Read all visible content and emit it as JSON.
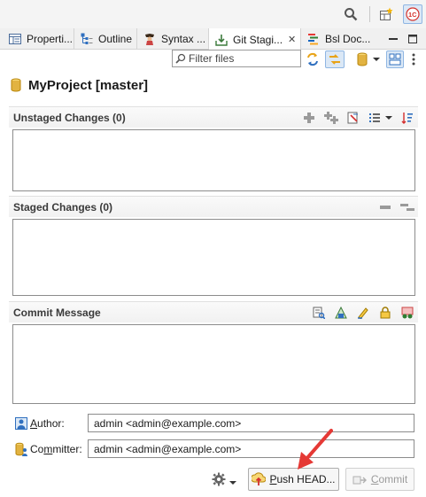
{
  "icons": {
    "search": "search-icon",
    "open_perspective": "open-perspective-icon",
    "perspective": "perspective-1c-icon",
    "properties_tab": "properties-icon",
    "outline_tab": "outline-icon",
    "syntax_tab": "syntax-icon",
    "git_staging_tab": "git-staging-icon",
    "bsl_doc_tab": "bsl-doc-icon",
    "repository": "repository-icon"
  },
  "tabs": [
    {
      "label": "Properti..."
    },
    {
      "label": "Outline"
    },
    {
      "label": "Syntax ..."
    },
    {
      "label": "Git Stagi...",
      "close": "✕"
    },
    {
      "label": "Bsl Doc..."
    }
  ],
  "filter": {
    "placeholder": "Filter files"
  },
  "repository": {
    "label": "MyProject [master]"
  },
  "unstaged": {
    "header": "Unstaged Changes (0)"
  },
  "staged": {
    "header": "Staged Changes (0)"
  },
  "commit_message": {
    "header": "Commit Message",
    "value": ""
  },
  "author": {
    "label": "Author:",
    "underline": "A",
    "rest": "uthor:",
    "value": "admin <admin@example.com>"
  },
  "committer": {
    "label": "Committer:",
    "underline": "m",
    "value": "admin <admin@example.com>"
  },
  "buttons": {
    "push_prefix": "",
    "push_underline": "P",
    "push_rest": "ush HEAD...",
    "commit_prefix": "",
    "commit_underline": "C",
    "commit_rest": "ommit"
  },
  "colors": {
    "accent_blue": "#2f6fbf",
    "repo_gold": "#e2b341",
    "arrow_red": "#e53935",
    "disabled_text": "#9a9a9a"
  }
}
